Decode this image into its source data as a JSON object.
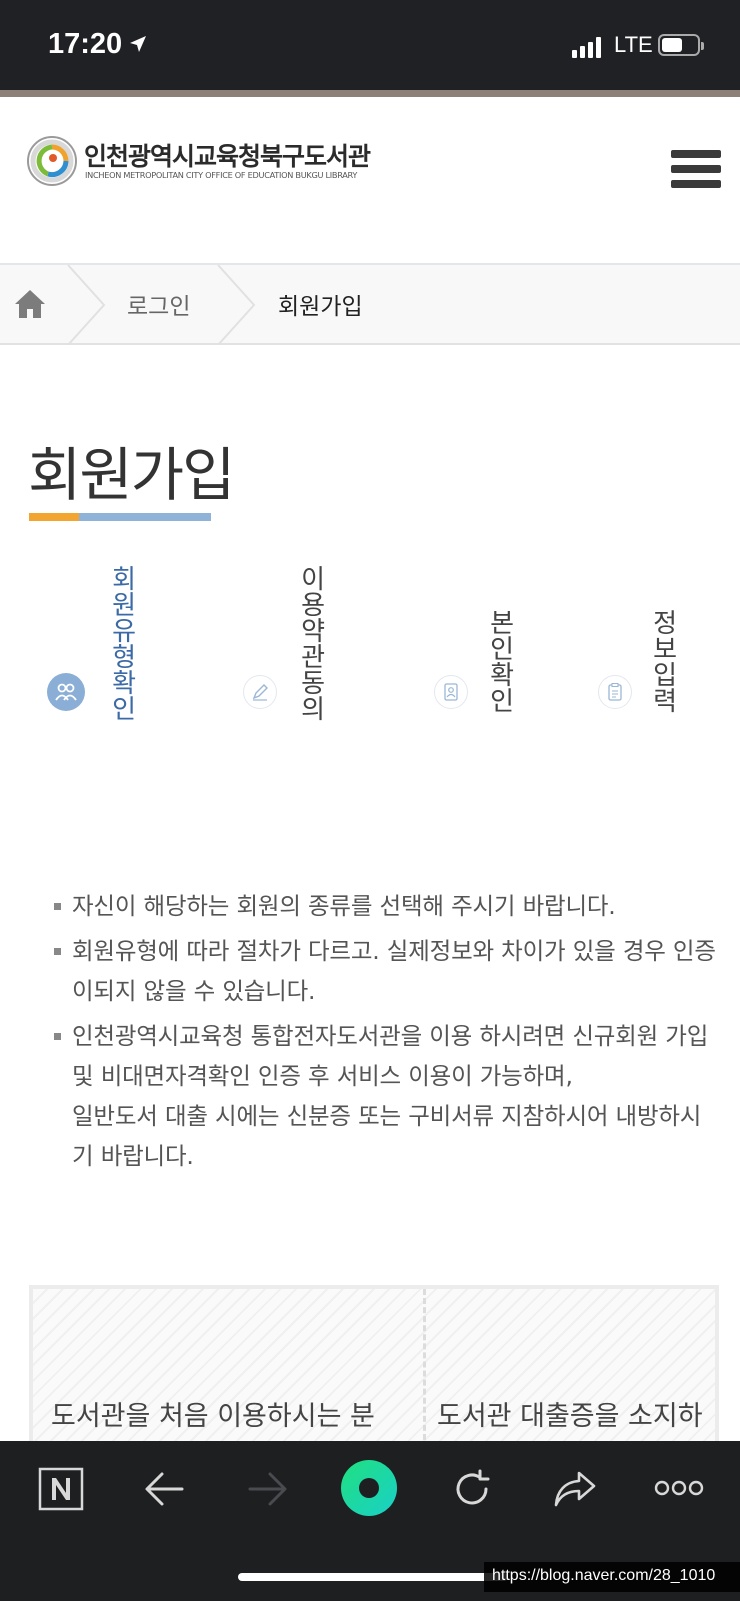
{
  "status_bar": {
    "time": "17:20",
    "network": "LTE"
  },
  "header": {
    "library_name_kr": "인천광역시교육청북구도서관",
    "library_name_en": "INCHEON METROPOLITAN CITY OFFICE OF EDUCATION BUKGU LIBRARY"
  },
  "breadcrumb": {
    "items": [
      "로그인",
      "회원가입"
    ]
  },
  "page": {
    "title": "회원가입"
  },
  "steps": [
    {
      "label": "회원유형확인",
      "active": true
    },
    {
      "label": "이용약관동의",
      "active": false
    },
    {
      "label": "본인확인",
      "active": false
    },
    {
      "label": "정보입력",
      "active": false
    }
  ],
  "notes": [
    "자신이 해당하는 회원의 종류를 선택해 주시기 바랍니다.",
    "회원유형에 따라 절차가 다르고. 실제정보와 차이가 있을 경우 인증이되지 않을 수 있습니다.",
    "인천광역시교육청 통합전자도서관을 이용 하시려면 신규회원 가입 및 비대면자격확인 인증 후 서비스 이용이 가능하며,",
    "일반도서 대출 시에는 신분증 또는 구비서류 지참하시어 내방하시기 바랍니다."
  ],
  "member_types": [
    "도서관을 처음 이용하시는 분",
    "도서관 대출증을 소지하"
  ],
  "watermark": "https://blog.naver.com/28_1010",
  "colors": {
    "accent_blue": "#3b6aa6",
    "step_active": "#8aaed6",
    "title_orange": "#f2a631",
    "toolbar_green": "#1fdc9a"
  }
}
